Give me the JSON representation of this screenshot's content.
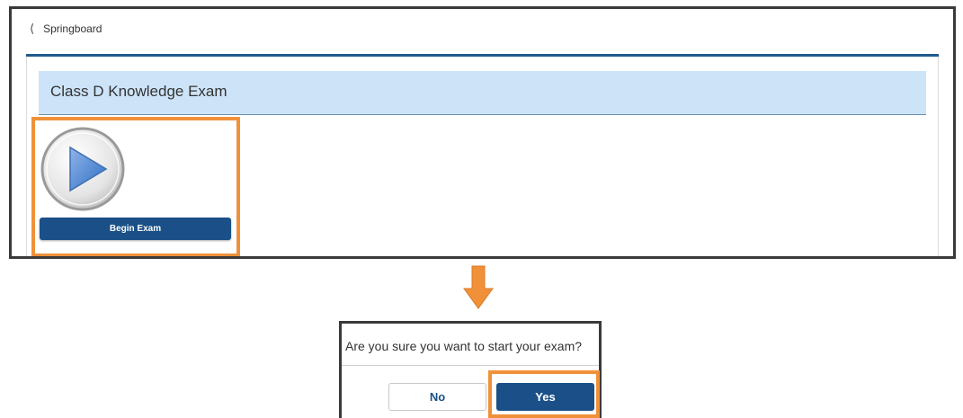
{
  "nav": {
    "back_label": "Springboard"
  },
  "exam": {
    "title": "Class D Knowledge Exam",
    "begin_label": "Begin Exam"
  },
  "dialog": {
    "message": "Are you sure you want to start your exam?",
    "no_label": "No",
    "yes_label": "Yes"
  },
  "icons": [
    "chevron-left-icon",
    "play-icon",
    "arrow-down-icon"
  ],
  "colors": {
    "highlight": "#f0913a",
    "primary_button": "#1a5087",
    "header_band": "#cde4f8",
    "frame": "#3a3a3a"
  }
}
